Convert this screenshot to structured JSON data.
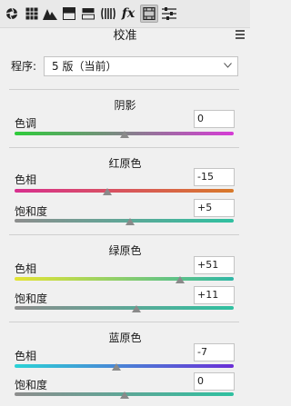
{
  "toolbar": {
    "icons": [
      {
        "name": "aperture-icon",
        "active": false
      },
      {
        "name": "grid-icon",
        "active": false
      },
      {
        "name": "mountain-icon",
        "active": false
      },
      {
        "name": "split-tone-icon",
        "active": false
      },
      {
        "name": "detail-icon",
        "active": false
      },
      {
        "name": "lens-icon",
        "active": false
      },
      {
        "name": "fx-icon",
        "active": false
      },
      {
        "name": "camera-calibration-icon",
        "active": true
      },
      {
        "name": "presets-sliders-icon",
        "active": false
      }
    ],
    "fx_label": "fx"
  },
  "panel": {
    "title": "校准"
  },
  "process": {
    "label": "程序:",
    "value": "5 版（当前）"
  },
  "sections": [
    {
      "title": "阴影",
      "sliders": [
        {
          "label": "色调",
          "value": "0",
          "num": 0
        }
      ]
    },
    {
      "title": "红原色",
      "sliders": [
        {
          "label": "色相",
          "value": "-15",
          "num": -15
        },
        {
          "label": "饱和度",
          "value": "+5",
          "num": 5
        }
      ]
    },
    {
      "title": "绿原色",
      "sliders": [
        {
          "label": "色相",
          "value": "+51",
          "num": 51
        },
        {
          "label": "饱和度",
          "value": "+11",
          "num": 11
        }
      ]
    },
    {
      "title": "蓝原色",
      "sliders": [
        {
          "label": "色相",
          "value": "-7",
          "num": -7
        },
        {
          "label": "饱和度",
          "value": "0",
          "num": 0
        }
      ]
    }
  ],
  "colors": {
    "tint": [
      "#2ecc3a",
      "#d63bd6"
    ],
    "red_hue": [
      "#d8308f",
      "#d87a2a"
    ],
    "green_hue": [
      "#e4e433",
      "#2fb6a6"
    ],
    "blue_hue": [
      "#2bd3d6",
      "#6a2ed6"
    ],
    "saturation": [
      "#8d8d8d",
      "#2fc0a0"
    ]
  }
}
